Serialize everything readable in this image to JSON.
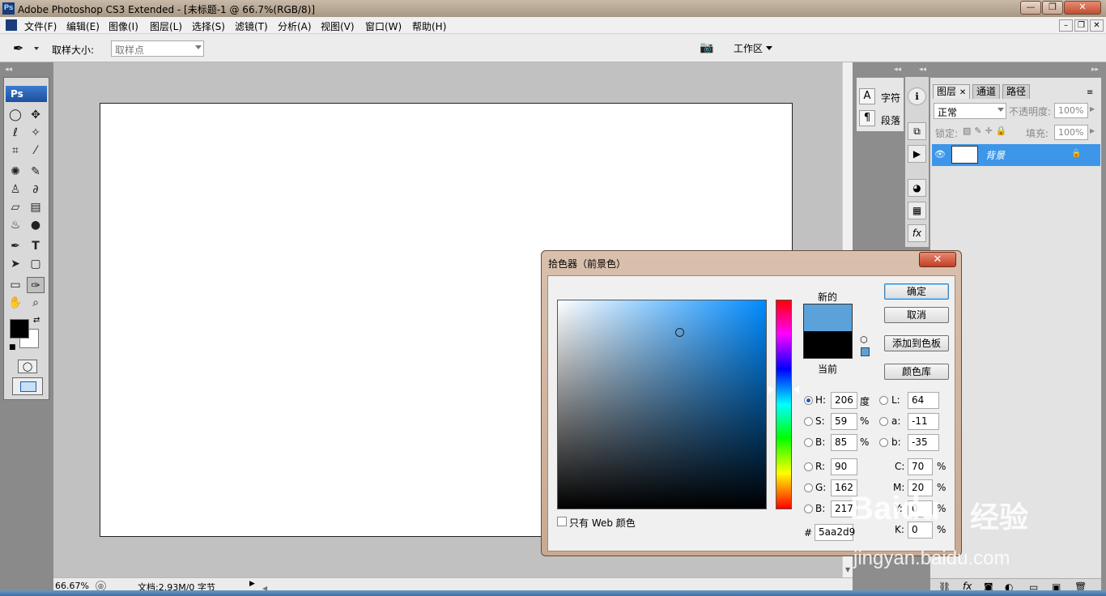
{
  "window": {
    "title": "Adobe Photoshop CS3 Extended - [未标题-1 @ 66.7%(RGB/8)]",
    "app_icon": "Ps"
  },
  "menubar": {
    "items": [
      "文件(F)",
      "编辑(E)",
      "图像(I)",
      "图层(L)",
      "选择(S)",
      "滤镜(T)",
      "分析(A)",
      "视图(V)",
      "窗口(W)",
      "帮助(H)"
    ]
  },
  "options": {
    "sample_size_label": "取样大小:",
    "sample_size_value": "取样点",
    "workspace_label": "工作区"
  },
  "toolbox": {
    "logo": "Ps",
    "foreground_color": "#000000",
    "background_color": "#ffffff"
  },
  "status": {
    "zoom": "66.67%",
    "doc_info": "文档:2.93M/0 字节"
  },
  "char_panel": {
    "char_label": "字符",
    "para_label": "段落"
  },
  "layers_panel": {
    "tabs": [
      "图层",
      "通道",
      "路径"
    ],
    "blend_mode": "正常",
    "opacity_label": "不透明度:",
    "opacity_value": "100%",
    "lock_label": "锁定:",
    "fill_label": "填充:",
    "fill_value": "100%",
    "layer_name": "背景"
  },
  "color_picker": {
    "title": "拾色器（前景色）",
    "new_label": "新的",
    "current_label": "当前",
    "new_color": "#5aa2d9",
    "current_color": "#000000",
    "buttons": {
      "ok": "确定",
      "cancel": "取消",
      "add_swatch": "添加到色板",
      "color_libraries": "颜色库"
    },
    "hsb": {
      "h_label": "H:",
      "h": "206",
      "h_unit": "度",
      "s_label": "S:",
      "s": "59",
      "s_unit": "%",
      "b_label": "B:",
      "b": "85",
      "b_unit": "%"
    },
    "lab": {
      "l_label": "L:",
      "l": "64",
      "a_label": "a:",
      "a": "-11",
      "b_label": "b:",
      "b": "-35"
    },
    "rgb": {
      "r_label": "R:",
      "r": "90",
      "g_label": "G:",
      "g": "162",
      "b_label": "B:",
      "b": "217"
    },
    "cmyk": {
      "c_label": "C:",
      "c": "70",
      "m_label": "M:",
      "m": "20",
      "y_label": "Y:",
      "y": "0",
      "k_label": "K:",
      "k": "0",
      "unit": "%"
    },
    "hex_label": "#",
    "hex": "5aa2d9",
    "web_only_label": "只有 Web 颜色",
    "hue_marker_fraction": 0.43
  },
  "watermark": {
    "brand": "Baidu",
    "cn": "经验",
    "url": "jingyan.baidu.com"
  }
}
